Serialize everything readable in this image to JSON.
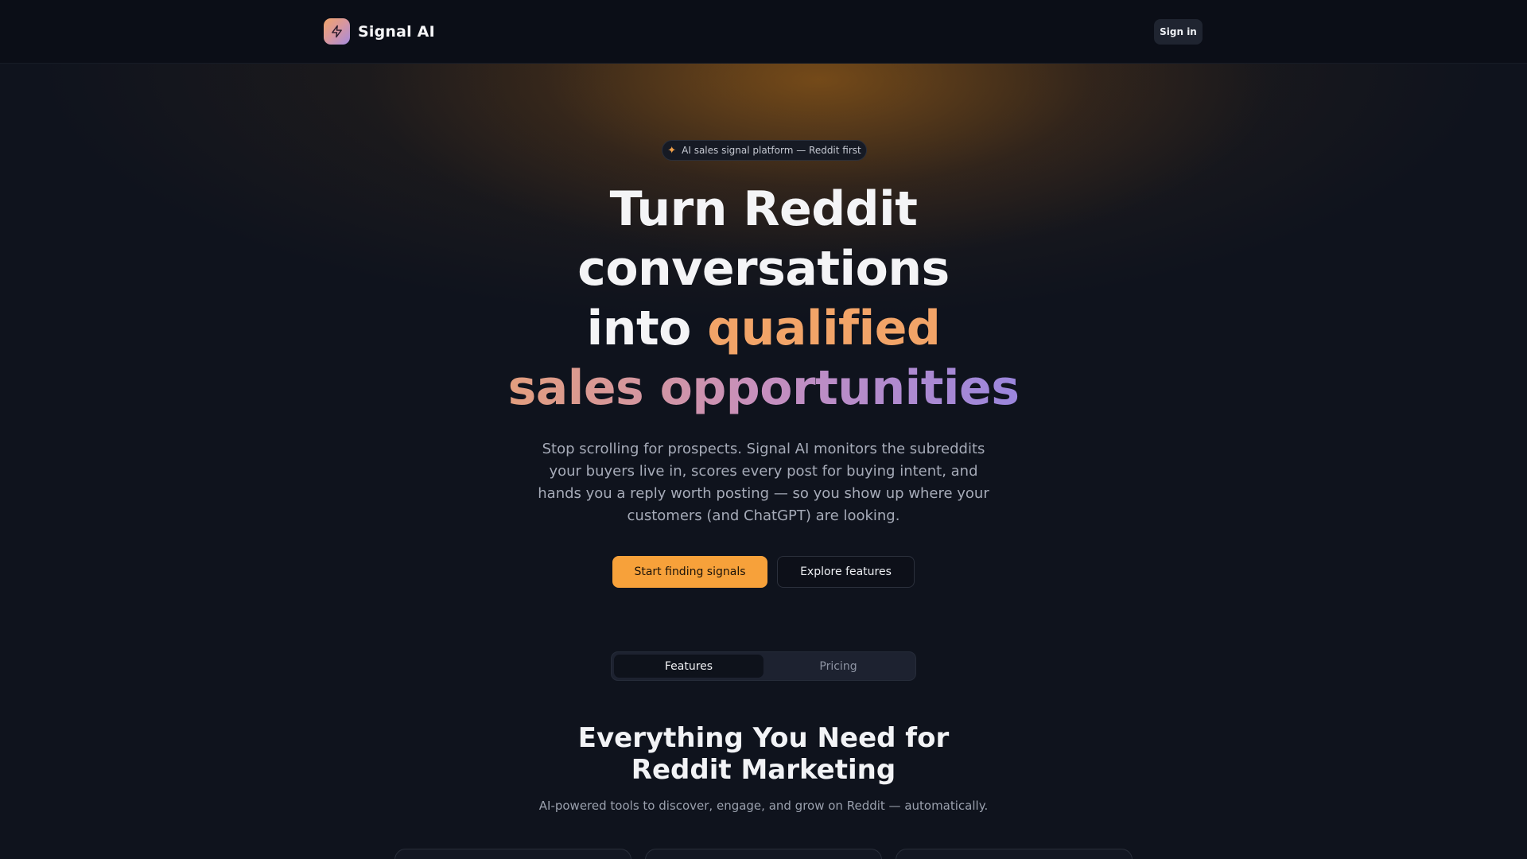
{
  "header": {
    "brand_name": "Signal AI",
    "logo_icon": "lightning-bolt-icon",
    "signin_label": "Sign in"
  },
  "hero": {
    "badge_icon": "sparkles-icon",
    "badge_text": "AI sales signal platform — Reddit first",
    "title_line1": "Turn Reddit",
    "title_line2": "conversations",
    "title_line3_plain": "into",
    "title_line3_accent": "qualified",
    "title_line4": "sales opportunities",
    "subtitle": "Stop scrolling for prospects. Signal AI monitors the subreddits your buyers live in, scores every post for buying intent, and hands you a reply worth posting — so you show up where your customers (and ChatGPT) are looking.",
    "cta_primary": "Start finding signals",
    "cta_secondary": "Explore features"
  },
  "tabs": {
    "items": [
      {
        "label": "Features",
        "active": true
      },
      {
        "label": "Pricing",
        "active": false
      }
    ]
  },
  "features": {
    "title": "Everything You Need for Reddit Marketing",
    "subtitle": "AI-powered tools to discover, engage, and grow on Reddit — automatically."
  },
  "colors": {
    "background": "#0f131d",
    "primary": "#f7a13a",
    "accent_orange": "#f2a468",
    "accent_purple": "#9b86dd"
  }
}
